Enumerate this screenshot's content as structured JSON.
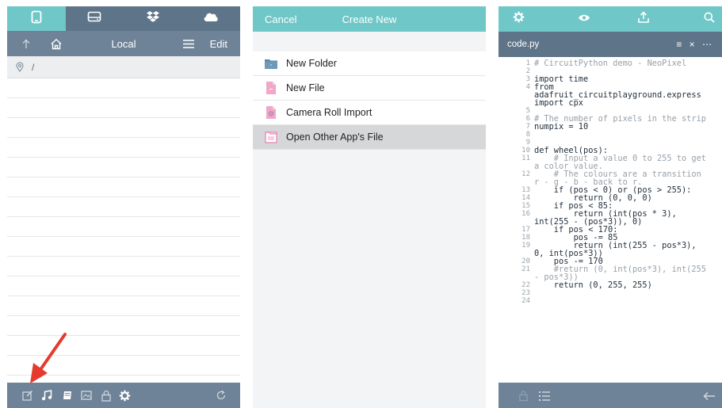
{
  "panel1": {
    "tabs": [
      {
        "icon": "tablet-icon"
      },
      {
        "icon": "drive-icon"
      },
      {
        "icon": "dropbox-icon"
      },
      {
        "icon": "cloud-icon"
      }
    ],
    "nav": {
      "title": "Local",
      "edit": "Edit"
    },
    "path": "/",
    "row_count": 16,
    "bottom_icons": [
      "compose-icon",
      "music-icon",
      "stack-icon",
      "image-folder-icon",
      "lock-icon",
      "gear-icon",
      "refresh-icon"
    ]
  },
  "panel2": {
    "header": {
      "cancel": "Cancel",
      "title": "Create New"
    },
    "menu": [
      {
        "label": "New Folder",
        "icon": "folder-icon",
        "color": "#5b8aa8"
      },
      {
        "label": "New File",
        "icon": "file-icon",
        "color": "#f0a7c8"
      },
      {
        "label": "Camera Roll Import",
        "icon": "camera-roll-icon",
        "color": "#f0a7c8"
      },
      {
        "label": "Open Other App's File",
        "icon": "open-file-icon",
        "color": "#f0a7c8",
        "selected": true
      }
    ]
  },
  "panel3": {
    "tabs": [
      "gear-icon",
      "eye-icon",
      "upload-icon",
      "search-icon"
    ],
    "file": {
      "name": "code.py",
      "actions": "≡ × ⋯"
    },
    "code": [
      {
        "n": "1",
        "t": "# CircuitPython demo - NeoPixel",
        "c": true
      },
      {
        "n": "2",
        "t": ""
      },
      {
        "n": "3",
        "t": "import time"
      },
      {
        "n": "4",
        "t": "from"
      },
      {
        "n": "",
        "t": "adafruit_circuitplayground.express"
      },
      {
        "n": "",
        "t": "import cpx"
      },
      {
        "n": "5",
        "t": ""
      },
      {
        "n": "6",
        "t": "# The number of pixels in the strip",
        "c": true
      },
      {
        "n": "7",
        "t": "numpix = 10"
      },
      {
        "n": "8",
        "t": ""
      },
      {
        "n": "9",
        "t": ""
      },
      {
        "n": "10",
        "t": "def wheel(pos):"
      },
      {
        "n": "11",
        "t": "    # Input a value 0 to 255 to get",
        "c": true
      },
      {
        "n": "",
        "t": "a color value.",
        "c": true
      },
      {
        "n": "12",
        "t": "    # The colours are a transition",
        "c": true
      },
      {
        "n": "",
        "t": "r - g - b - back to r.",
        "c": true
      },
      {
        "n": "13",
        "t": "    if (pos < 0) or (pos > 255):"
      },
      {
        "n": "14",
        "t": "        return (0, 0, 0)"
      },
      {
        "n": "15",
        "t": "    if pos < 85:"
      },
      {
        "n": "16",
        "t": "        return (int(pos * 3),"
      },
      {
        "n": "",
        "t": "int(255 - (pos*3)), 0)"
      },
      {
        "n": "17",
        "t": "    if pos < 170:"
      },
      {
        "n": "18",
        "t": "        pos -= 85"
      },
      {
        "n": "19",
        "t": "        return (int(255 - pos*3),"
      },
      {
        "n": "",
        "t": "0, int(pos*3))"
      },
      {
        "n": "20",
        "t": "    pos -= 170"
      },
      {
        "n": "21",
        "t": "    #return (0, int(pos*3), int(255",
        "c": true
      },
      {
        "n": "",
        "t": "- pos*3))",
        "c": true
      },
      {
        "n": "22",
        "t": "    return (0, 255, 255)"
      },
      {
        "n": "23",
        "t": ""
      },
      {
        "n": "24",
        "t": ""
      }
    ],
    "bottom_icons": [
      "lock-icon",
      "list-icon",
      "back-arrow-icon"
    ]
  },
  "colors": {
    "teal": "#6fc7c8",
    "slate": "#5e7488",
    "slate_light": "#6e8397",
    "arrow": "#e53b2f"
  }
}
